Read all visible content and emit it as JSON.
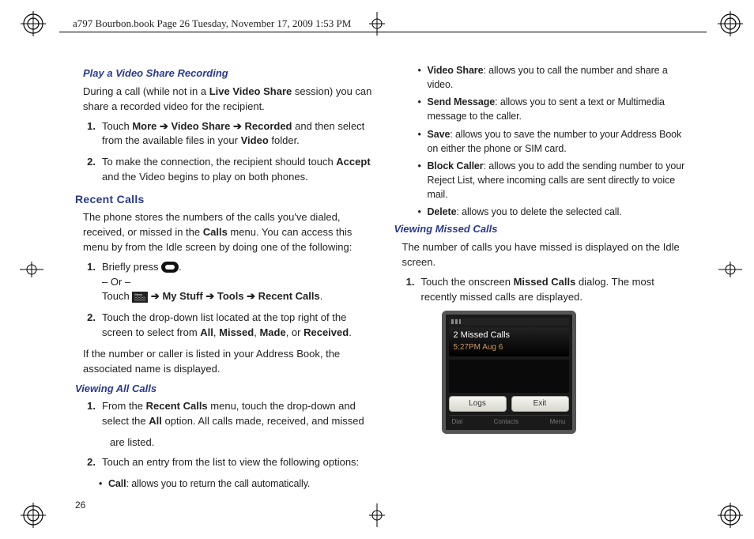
{
  "meta": {
    "header_line": "a797 Bourbon.book  Page 26  Tuesday, November 17, 2009  1:53 PM",
    "page_number": "26"
  },
  "col1": {
    "h_play": "Play a Video Share Recording",
    "p_play_intro_a": "During a call (while not in a ",
    "p_play_intro_b": "Live Video Share",
    "p_play_intro_c": " session) you can share a recorded video for the recipient.",
    "step1": {
      "num": "1.",
      "a": "Touch ",
      "more": "More",
      "arr1": " ➔ ",
      "vs": "Video Share",
      "arr2": " ➔ ",
      "rec": "Recorded",
      "b": " and then select from the available files in your ",
      "video": "Video",
      "c": " folder."
    },
    "step2": {
      "num": "2.",
      "a": "To make the connection, the recipient should touch ",
      "accept": "Accept",
      "b": " and the Video begins to play on both phones."
    },
    "h_recent": "Recent Calls",
    "p_recent_a": "The phone stores the numbers of the calls you've dialed, received, or missed in the ",
    "calls": "Calls",
    "p_recent_b": " menu. You can access this menu by from the Idle screen by doing one of the following:",
    "rstep1": {
      "num": "1.",
      "a": "Briefly press ",
      "dot": ".",
      "or": "– Or –",
      "t": "Touch ",
      "arr1": " ➔ ",
      "mystuff": "My Stuff",
      "arr2": " ➔ ",
      "tools": "Tools ",
      "arr3": " ➔ ",
      "recent": "Recent Calls",
      "dot2": "."
    },
    "rstep2": {
      "num": "2.",
      "a": "Touch the drop-down list located at the top right of the screen to select from ",
      "all": "All",
      "c1": ", ",
      "missed": "Missed",
      "c2": ", ",
      "made": "Made",
      "c3": ", or ",
      "received": "Received",
      "dot": "."
    },
    "p_addr": "If the number or caller is listed in your Address Book, the associated name is displayed.",
    "h_viewall": "Viewing All Calls",
    "vstep1": {
      "num": "1.",
      "a": "From the ",
      "rc": "Recent Calls",
      "b": " menu, touch the drop-down and select the ",
      "all": "All",
      "c": " option. All calls made, received, and missed"
    }
  },
  "col2": {
    "p_are": "are listed.",
    "step2": {
      "num": "2.",
      "a": "Touch an entry from the list to view the following options:"
    },
    "opts": {
      "call_l": "Call",
      "call_t": ": allows you to return the call automatically.",
      "vs_l": "Video Share",
      "vs_t": ": allows you to call the number and share a video.",
      "sm_l": "Send Message",
      "sm_t": ": allows you to sent a text or Multimedia message to the caller.",
      "save_l": "Save",
      "save_t": ": allows you to save the number to your Address Book on either the phone or SIM card.",
      "bc_l": "Block Caller",
      "bc_t": ": allows you to add the sending number to your Reject List, where incoming calls are sent directly to voice mail.",
      "del_l": "Delete",
      "del_t": ": allows you to delete the selected call."
    },
    "h_missed": "Viewing Missed Calls",
    "p_missed": "The number of calls you have missed is displayed on the Idle screen.",
    "mstep1": {
      "num": "1.",
      "a": "Touch the onscreen ",
      "mc": "Missed Calls",
      "b": " dialog. The most recently missed calls are displayed."
    }
  },
  "phone": {
    "title": "2 Missed Calls",
    "time": "5:27PM Aug 6",
    "btn_logs": "Logs",
    "btn_exit": "Exit",
    "bb_dial": "Dial",
    "bb_contacts": "Contacts",
    "bb_menu": "Menu"
  }
}
